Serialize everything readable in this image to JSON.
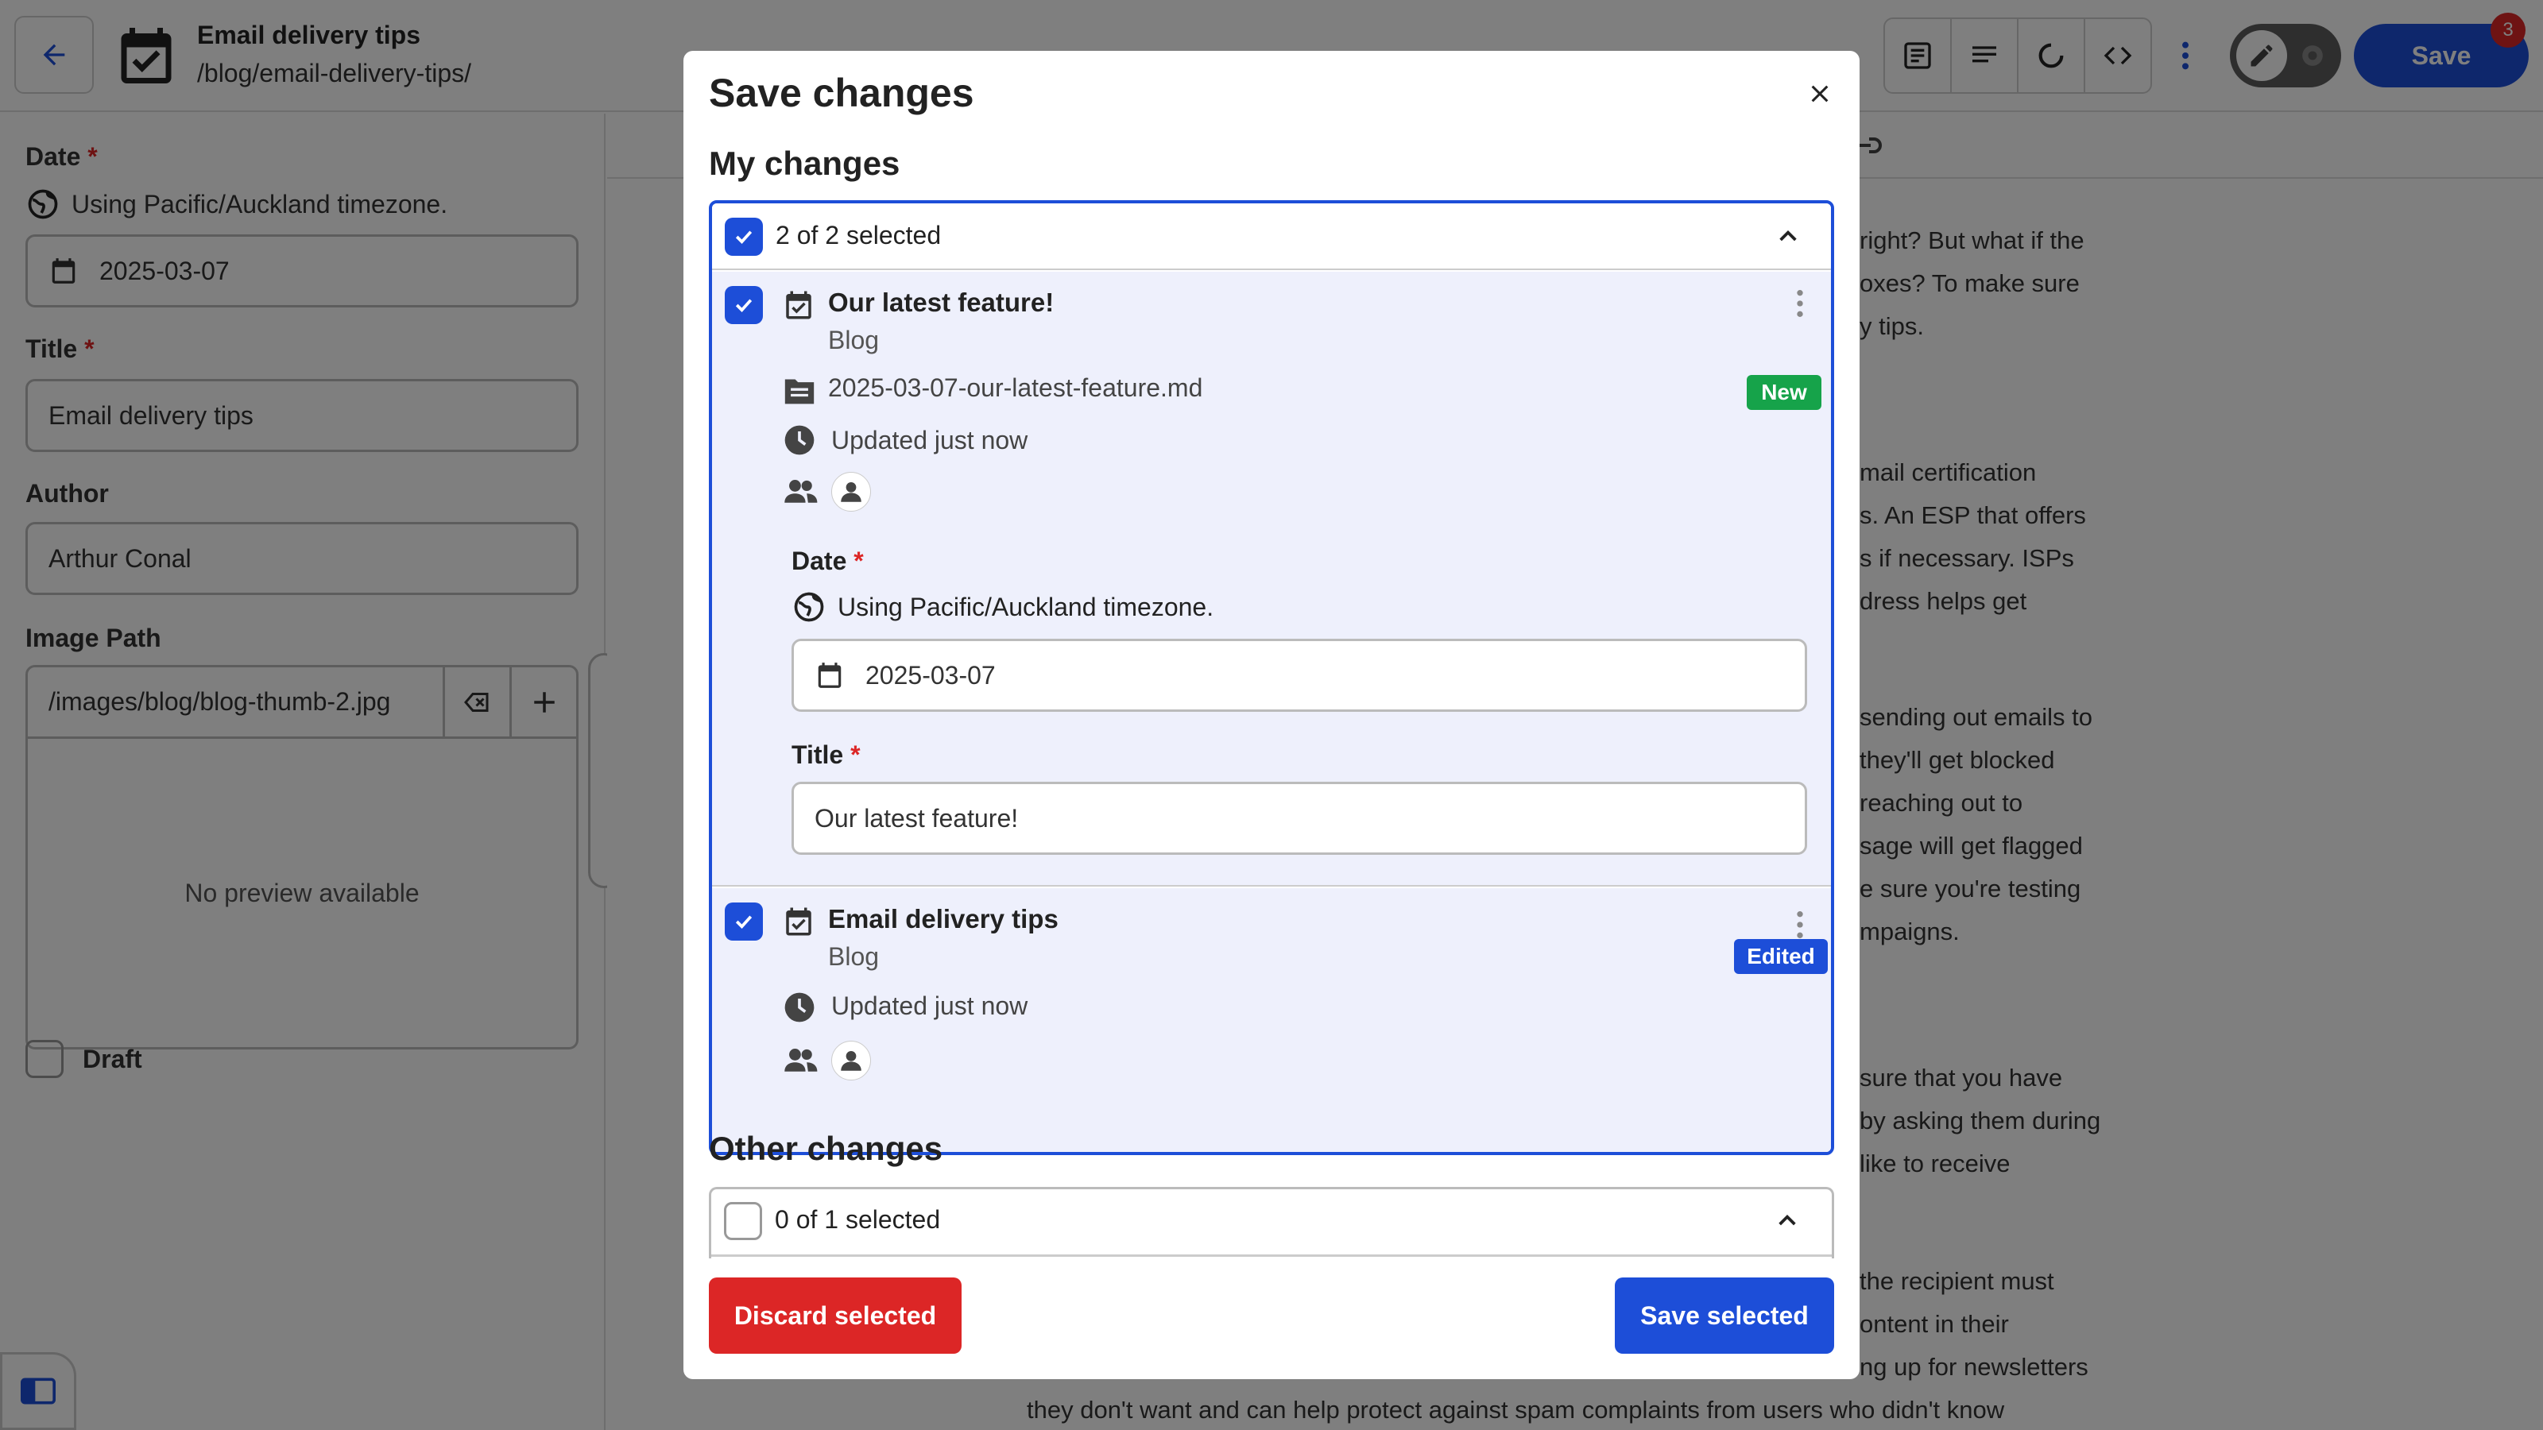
{
  "header": {
    "title": "Email delivery tips",
    "path": "/blog/email-delivery-tips/",
    "save_label": "Save",
    "save_badge": "3"
  },
  "editor": {
    "date_label": "Date",
    "timezone_note": "Using Pacific/Auckland timezone.",
    "date_value": "2025-03-07",
    "title_label": "Title",
    "title_value": "Email delivery tips",
    "author_label": "Author",
    "author_value": "Arthur Conal",
    "image_label": "Image Path",
    "image_value": "/images/blog/blog-thumb-2.jpg",
    "no_preview": "No preview available",
    "draft_label": "Draft",
    "required_mark": "*"
  },
  "body_text": [
    "right? But what if the",
    "oxes? To make sure",
    "y tips.",
    "mail certification",
    "s. An ESP that offers",
    "s if necessary. ISPs",
    "dress helps get",
    "sending out emails to",
    "they'll get blocked",
    "reaching out to",
    "sage will get flagged",
    "e sure you're testing",
    "mpaigns.",
    "sure that you have",
    "by asking them during",
    "like to receive",
    "the recipient must",
    "ontent in their",
    "ng up for newsletters",
    "they don't want and can help protect against spam complaints from users who didn't know"
  ],
  "modal": {
    "title": "Save changes",
    "my_changes_title": "My changes",
    "my_changes_count": "2 of 2 selected",
    "other_changes_title": "Other changes",
    "other_changes_count": "0 of 1 selected",
    "discard_label": "Discard selected",
    "save_label": "Save selected",
    "items": [
      {
        "title": "Our latest feature!",
        "collection": "Blog",
        "file": "2025-03-07-our-latest-feature.md",
        "status": "New",
        "status_color": "#16a34a",
        "updated": "Updated just now",
        "fields": {
          "date_label": "Date",
          "timezone_note": "Using Pacific/Auckland timezone.",
          "date_value": "2025-03-07",
          "title_label": "Title",
          "title_value": "Our latest feature!"
        }
      },
      {
        "title": "Email delivery tips",
        "collection": "Blog",
        "status": "Edited",
        "status_color": "#1d4ed8",
        "updated": "Updated just now"
      }
    ]
  },
  "colors": {
    "accent": "#1d4ed8",
    "danger": "#dc2626",
    "new_badge": "#16a34a",
    "item_background": "#eef0fc"
  }
}
